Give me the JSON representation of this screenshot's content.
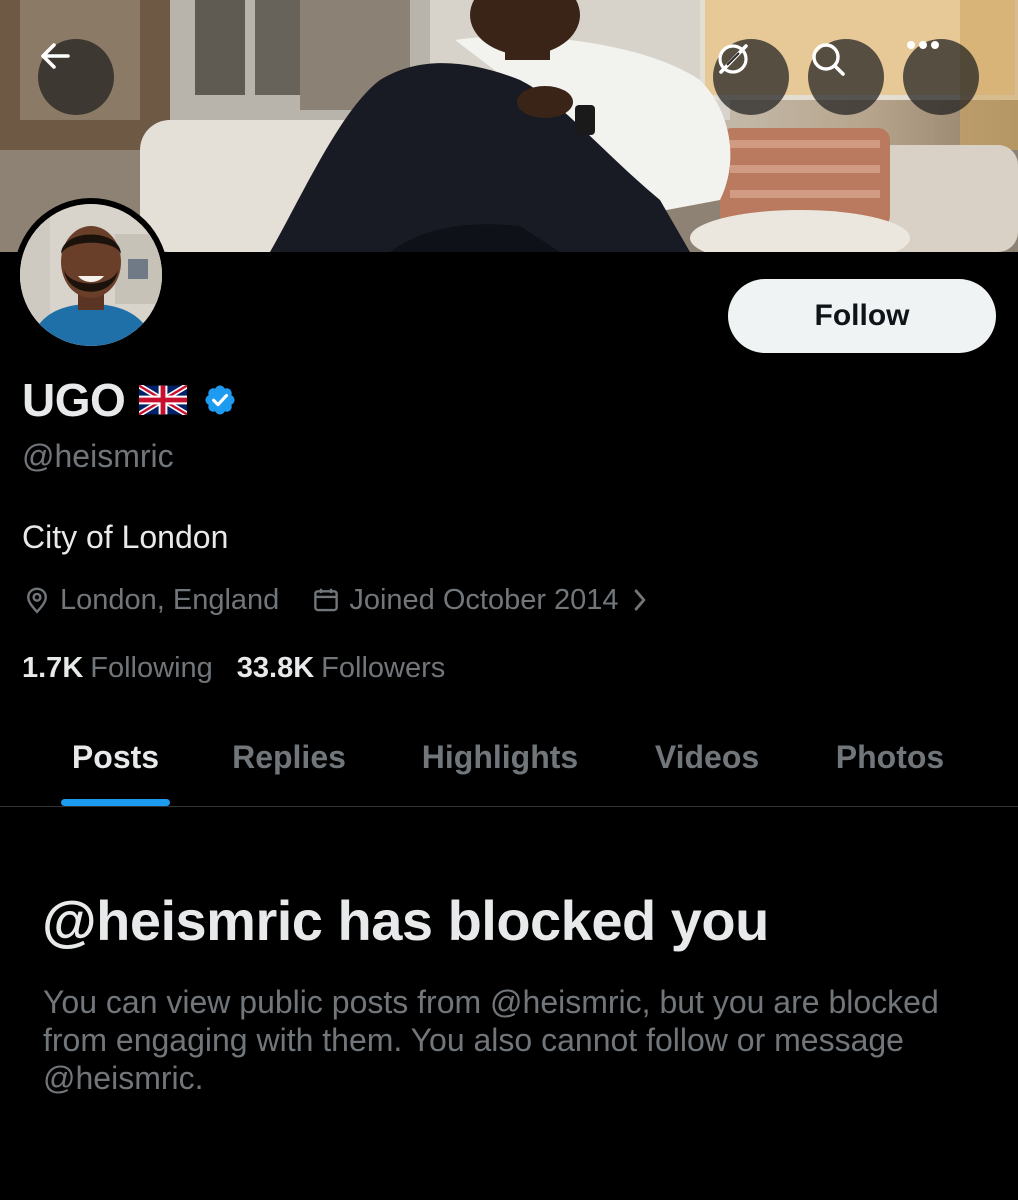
{
  "header": {
    "back_icon": "arrow-left-icon",
    "grok_icon": "grok-icon",
    "search_icon": "search-icon",
    "more_icon": "more-horizontal-icon"
  },
  "profile": {
    "display_name": "UGO",
    "flag_icon": "uk-flag-icon",
    "verified": true,
    "handle": "@heismric",
    "bio": "City of London",
    "location": "London, England",
    "joined": "Joined October 2014",
    "following_count": "1.7K",
    "following_label": "Following",
    "followers_count": "33.8K",
    "followers_label": "Followers",
    "follow_label": "Follow"
  },
  "tabs": [
    {
      "label": "Posts",
      "active": true
    },
    {
      "label": "Replies",
      "active": false
    },
    {
      "label": "Highlights",
      "active": false
    },
    {
      "label": "Videos",
      "active": false
    },
    {
      "label": "Photos",
      "active": false
    }
  ],
  "blocked": {
    "title": "@heismric has blocked you",
    "message": "You can view public posts from @heismric, but you are blocked from engaging with them. You also cannot follow or message @heismric."
  },
  "colors": {
    "background": "#000000",
    "primary_text": "#e7e9ea",
    "secondary_text": "#71767b",
    "accent": "#1d9bf0",
    "verified_badge": "#1d9bf0"
  }
}
